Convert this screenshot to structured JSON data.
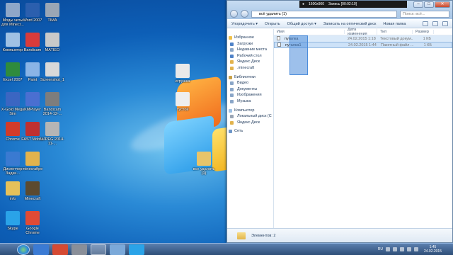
{
  "desktop": {
    "icons": [
      {
        "label": "Моды читы для Minecr...",
        "color": "#8fa7c8"
      },
      {
        "label": "Word 2007",
        "color": "#2b5fae"
      },
      {
        "label": "TIMA",
        "color": "#9aa6b5"
      },
      {
        "label": "Компьютер",
        "color": "#9fc1e4"
      },
      {
        "label": "Bandicam",
        "color": "#d83b3b"
      },
      {
        "label": "MATIEO",
        "color": "#c9c9c9"
      },
      {
        "label": "Excel 2007",
        "color": "#2f8b3d"
      },
      {
        "label": "Paint",
        "color": "#8ab4e6"
      },
      {
        "label": "Screenshot_1",
        "color": "#d9d9d9"
      },
      {
        "label": "X-Gold Mega Sim",
        "color": "#3b66c2"
      },
      {
        "label": "KMPlayer",
        "color": "#4a6fd1"
      },
      {
        "label": "Bandicam 2014-12-...",
        "color": "#7d7d7d"
      },
      {
        "label": "Chrome",
        "color": "#d23b2a"
      },
      {
        "label": "FAST Mobile",
        "color": "#c03030"
      },
      {
        "label": "UJPEG 2014-11-...",
        "color": "#b5b5b5"
      },
      {
        "label": "Диспетчер Задач...",
        "color": "#3a7ad1"
      },
      {
        "label": "minecraftpe",
        "color": "#e2b34d"
      },
      {
        "label": "info",
        "color": "#e6c15a"
      },
      {
        "label": "Minecraft",
        "color": "#5c4a2f"
      },
      {
        "label": "Skype",
        "color": "#2aa3e8"
      },
      {
        "label": "Google Chrome",
        "color": "#e04a35"
      },
      {
        "label": "игрушка",
        "color": "#e9e9e9"
      },
      {
        "label": "пустой",
        "color": "#eeeeee"
      },
      {
        "label": "все удалить (1)",
        "color": "#e8c46a"
      }
    ]
  },
  "window": {
    "recorder": {
      "resolution": "1600x900",
      "record_label": "Запись [00:02:10]"
    },
    "address": "всё удалить (1)",
    "search_placeholder": "Поиск: всё...",
    "toolbar": {
      "organize": "Упорядочить ▾",
      "open": "Открыть",
      "share": "Общий доступ ▾",
      "burn": "Записать на оптический диск",
      "new_folder": "Новая папка"
    },
    "nav": [
      {
        "label": "Избранное",
        "group": true,
        "color": "#f0c24a"
      },
      {
        "label": "Загрузки",
        "group": false,
        "color": "#4f82c8"
      },
      {
        "label": "Недавние места",
        "group": false,
        "color": "#8aa6c8"
      },
      {
        "label": "Рабочий стол",
        "group": false,
        "color": "#4f82c8"
      },
      {
        "label": "Яндекс.Диск",
        "group": false,
        "color": "#e2b34d"
      },
      {
        "label": ".minecraft",
        "group": false,
        "color": "#e2b34d"
      },
      {
        "label": "Библиотеки",
        "group": true,
        "color": "#c9a24a"
      },
      {
        "label": "Видео",
        "group": false,
        "color": "#8aa6c8"
      },
      {
        "label": "Документы",
        "group": false,
        "color": "#8aa6c8"
      },
      {
        "label": "Изображения",
        "group": false,
        "color": "#8aa6c8"
      },
      {
        "label": "Музыка",
        "group": false,
        "color": "#8aa6c8"
      },
      {
        "label": "Компьютер",
        "group": true,
        "color": "#9fc1e4"
      },
      {
        "label": "Локальный диск (C",
        "group": false,
        "color": "#9aa6b5"
      },
      {
        "label": "Яндекс.Диск",
        "group": false,
        "color": "#e2b34d"
      },
      {
        "label": "Сеть",
        "group": true,
        "color": "#6f97c8"
      }
    ],
    "columns": {
      "name": "Имя",
      "date": "Дата изменения",
      "type": "Тип",
      "size": "Размер"
    },
    "files": [
      {
        "name": "пугалка",
        "date": "24.02.2015 1:18",
        "type": "Текстовый докум...",
        "size": "1 КБ"
      },
      {
        "name": "пугалка1",
        "date": "24.02.2015 1:44",
        "type": "Пакетный файл ...",
        "size": "1 КБ"
      }
    ],
    "status": "Элементов: 2"
  },
  "taskbar": {
    "time": "1:45",
    "date": "24.02.2015",
    "lang": "RU"
  }
}
